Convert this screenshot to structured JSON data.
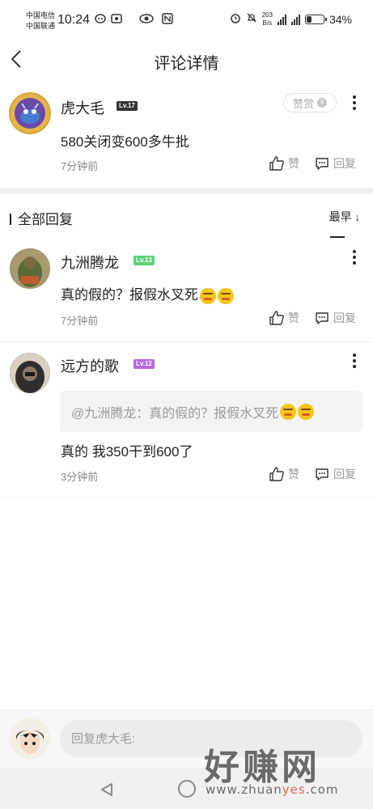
{
  "status_bar": {
    "carrier_1": "中国电信",
    "carrier_2": "中国联通",
    "time": "10:24",
    "net_speed_value": "203",
    "net_speed_unit": "B/s",
    "battery_percent": "34%",
    "battery_level": 0.34
  },
  "header": {
    "title": "评论详情"
  },
  "main_comment": {
    "user_name": "虎大毛",
    "level": "Lv.17",
    "level_color": "#333333",
    "reward_label": "赞赏",
    "content": "580关闭变600多牛批",
    "time": "7分钟前",
    "like_label": "赞",
    "reply_label": "回复"
  },
  "replies_section": {
    "title": "全部回复",
    "sort_label": "最早"
  },
  "replies": [
    {
      "user_name": "九洲腾龙",
      "level": "Lv.13",
      "level_color": "#5fd07a",
      "content": "真的假的？报假水叉死",
      "time": "7分钟前",
      "like_label": "赞",
      "reply_label": "回复"
    },
    {
      "user_name": "远方的歌",
      "level": "Lv.12",
      "level_color": "#b36ae0",
      "quote": "@九洲腾龙：真的假的？报假水叉死",
      "content": "真的 我350干到600了",
      "time": "3分钟前",
      "like_label": "赞",
      "reply_label": "回复"
    }
  ],
  "reply_box": {
    "placeholder": "回复虎大毛:"
  },
  "watermark": {
    "main": "好赚网",
    "sub_prefix": "www.zhuan",
    "sub_accent": "yes",
    "sub_suffix": ".com"
  },
  "icons": {
    "back": "chevron-left-icon",
    "more": "more-vertical-icon",
    "like": "thumbs-up-icon",
    "reply": "comment-icon"
  }
}
